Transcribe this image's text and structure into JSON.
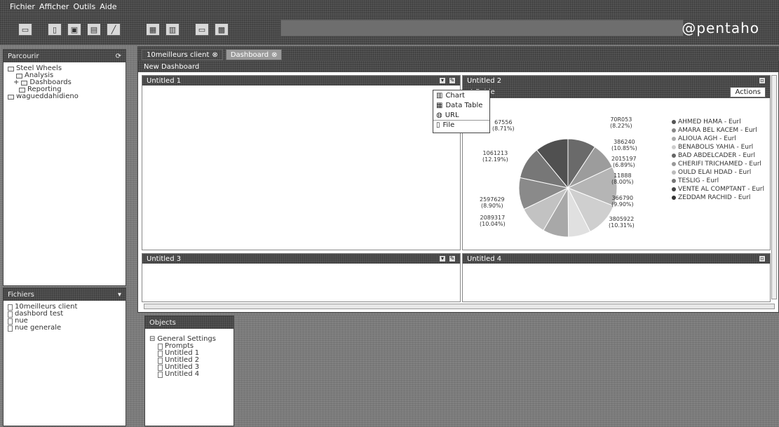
{
  "menu": [
    "Fichier",
    "Afficher",
    "Outils",
    "Aide"
  ],
  "brand": "@pentaho",
  "browse": {
    "title": "Parcourir",
    "tree": [
      "Steel Wheels",
      "Analysis",
      "Dashboards",
      "Reporting",
      "wagueddahidieno"
    ]
  },
  "files": {
    "title": "Fichiers",
    "items": [
      "10meilleurs client",
      "dashbord test",
      "nue",
      "nue generale"
    ]
  },
  "tabs": [
    "10meilleurs client",
    "Dashboard"
  ],
  "dashboard": {
    "title": "New Dashboard",
    "widgets": {
      "w1": "Untitled 1",
      "w2": "Untitled 2",
      "w3": "Untitled 3",
      "w4": "Untitled 4"
    },
    "chart_title": "st Pnide",
    "actions": "Actions"
  },
  "menu_popup": [
    "Chart",
    "Data Table",
    "URL",
    "File"
  ],
  "chart_labels": [
    {
      "v": "67556",
      "p": "(8.71%)"
    },
    {
      "v": "70R053",
      "p": "(8.22%)"
    },
    {
      "v": "1061213",
      "p": "(12.19%)"
    },
    {
      "v": "386240",
      "p": "(10.85%)"
    },
    {
      "v": "2015197",
      "p": "(6.89%)"
    },
    {
      "v": "11888",
      "p": "(8.00%)"
    },
    {
      "v": "2597629",
      "p": "(8.90%)"
    },
    {
      "v": "366790",
      "p": "(9.90%)"
    },
    {
      "v": "2089317",
      "p": "(10.04%)"
    },
    {
      "v": "3805922",
      "p": "(10.31%)"
    }
  ],
  "legend": [
    "AHMED HAMA - Eurl",
    "AMARA BEL KACEM - Eurl",
    "ALIOUA AGH - Eurl",
    "BENABOLIS YAHIA - Eurl",
    "BAD ABDELCADER - Eurl",
    "CHERIFI TRICHAMED - Eurl",
    "OULD ELAI HDAD - Eurl",
    "TESLIG - Eurl",
    "VENTE AL COMPTANT - Eurl",
    "ZEDDAM RACHID - Eurl"
  ],
  "objects": {
    "title": "Objects",
    "items": [
      "General Settings",
      "Prompts",
      "Untitled 1",
      "Untitled 2",
      "Untitled 3",
      "Untitled 4"
    ]
  },
  "colors": {
    "slices": [
      "#6a6a6a",
      "#9c9c9c",
      "#b5b5b5",
      "#cfcfcf",
      "#e0e0e0",
      "#a8a8a8",
      "#c2c2c2",
      "#8a8a8a",
      "#777777",
      "#505050"
    ],
    "legend_dots": [
      "#555",
      "#888",
      "#aaa",
      "#ccc",
      "#666",
      "#999",
      "#bbb",
      "#777",
      "#444",
      "#333"
    ]
  }
}
